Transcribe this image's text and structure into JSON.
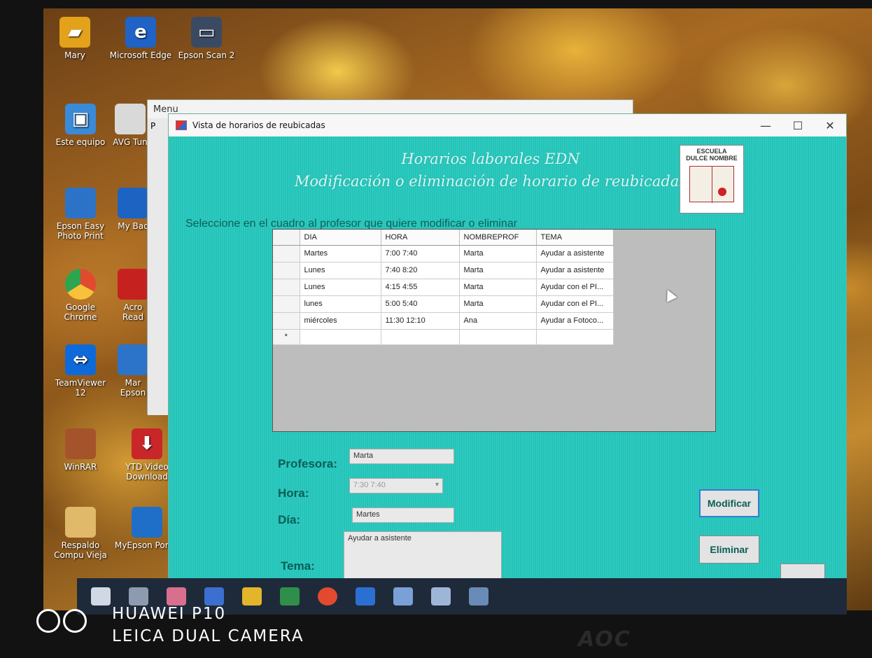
{
  "desktop_icons": [
    {
      "label": "Mary",
      "icon": "folder-icon",
      "color": "#e3a21a"
    },
    {
      "label": "Microsoft Edge",
      "icon": "edge-icon",
      "color": "#1f63c6"
    },
    {
      "label": "Epson Scan 2",
      "icon": "scanner-icon",
      "color": "#3b4a63"
    },
    {
      "label": "Este equipo",
      "icon": "computer-icon",
      "color": "#3a8ad8"
    },
    {
      "label": "AVG Tun",
      "icon": "avg-icon",
      "color": "#d9d9d9"
    },
    {
      "label": "Epson Easy Photo Print",
      "icon": "photo-print-icon",
      "color": "#2c73c8"
    },
    {
      "label": "My Bac",
      "icon": "backup-icon",
      "color": "#1d64c2"
    },
    {
      "label": "Google Chrome",
      "icon": "chrome-icon",
      "color": "#e24a2f"
    },
    {
      "label": "Acro Read",
      "icon": "acrobat-icon",
      "color": "#c5221f"
    },
    {
      "label": "TeamViewer 12",
      "icon": "teamviewer-icon",
      "color": "#0e6ad8"
    },
    {
      "label": "Mar Epson",
      "icon": "manual-icon",
      "color": "#2b74c9"
    },
    {
      "label": "WinRAR",
      "icon": "winrar-icon",
      "color": "#a5532b"
    },
    {
      "label": "YTD Video Download",
      "icon": "download-icon",
      "color": "#c9262a"
    },
    {
      "label": "Respaldo Compu Vieja",
      "icon": "folder-icon",
      "color": "#e0b96a"
    },
    {
      "label": "MyEpson Portal",
      "icon": "portal-icon",
      "color": "#1f6fc9"
    }
  ],
  "background_window": {
    "title": "Menu",
    "short": "P"
  },
  "window": {
    "title": "Vista de horarios de reubicadas",
    "minimize": "—",
    "maximize": "☐",
    "close": "✕"
  },
  "heading": {
    "line1": "Horarios laborales EDN",
    "line2": "Modificación o eliminación de horario de reubicadas"
  },
  "logo": {
    "line1": "ESCUELA",
    "line2": "DULCE NOMBRE"
  },
  "instruction": "Seleccione en el cuadro al profesor que quiere modificar o eliminar",
  "grid": {
    "columns": [
      "DIA",
      "HORA",
      "NOMBREPROF",
      "TEMA"
    ],
    "rows": [
      {
        "dia": "Martes",
        "hora": "7:00  7:40",
        "prof": "Marta",
        "tema": "Ayudar a asistente"
      },
      {
        "dia": "Lunes",
        "hora": "7:40  8:20",
        "prof": "Marta",
        "tema": "Ayudar a asistente"
      },
      {
        "dia": "Lunes",
        "hora": "4:15  4:55",
        "prof": "Marta",
        "tema": "Ayudar con el PI..."
      },
      {
        "dia": "lunes",
        "hora": "5:00  5:40",
        "prof": "Marta",
        "tema": "Ayudar con el PI..."
      },
      {
        "dia": "miércoles",
        "hora": "11:30  12:10",
        "prof": "Ana",
        "tema": "Ayudar a Fotoco..."
      }
    ],
    "new_row_marker": "*"
  },
  "form": {
    "profesora_label": "Profesora:",
    "profesora_value": "Marta",
    "hora_label": "Hora:",
    "hora_value": "7:30  7:40",
    "dia_label": "Día:",
    "dia_value": "Martes",
    "tema_label": "Tema:",
    "tema_value": "Ayudar a asistente"
  },
  "buttons": {
    "modificar": "Modificar",
    "eliminar": "Eliminar"
  },
  "watermark": {
    "line1": "HUAWEI P10",
    "line2": "LEICA DUAL CAMERA"
  },
  "monitor_brand": "AOC"
}
